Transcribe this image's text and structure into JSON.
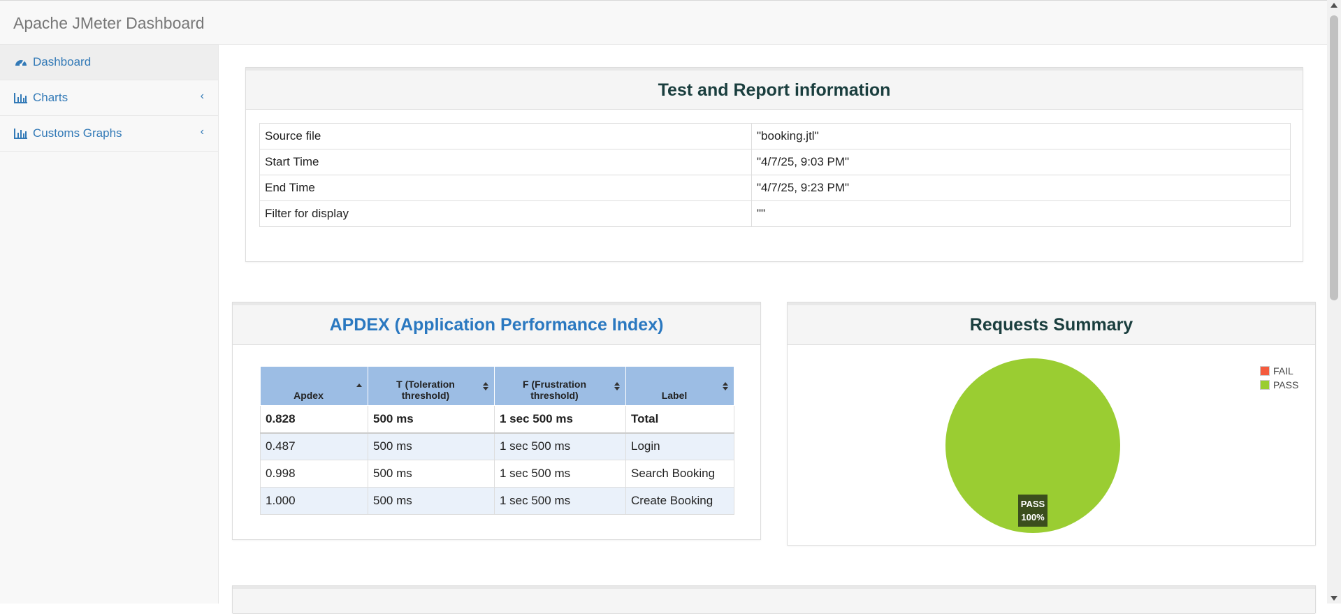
{
  "app": {
    "title": "Apache JMeter Dashboard"
  },
  "sidebar": {
    "items": [
      {
        "label": "Dashboard",
        "icon": "dashboard-icon",
        "active": true
      },
      {
        "label": "Charts",
        "icon": "bar-chart-icon"
      },
      {
        "label": "Customs Graphs",
        "icon": "bar-chart-icon"
      }
    ]
  },
  "test_info": {
    "title": "Test and Report information",
    "rows": [
      {
        "key": "Source file",
        "value": "\"booking.jtl\""
      },
      {
        "key": "Start Time",
        "value": "\"4/7/25, 9:03 PM\""
      },
      {
        "key": "End Time",
        "value": "\"4/7/25, 9:23 PM\""
      },
      {
        "key": "Filter for display",
        "value": "\"\""
      }
    ]
  },
  "apdex": {
    "title": "APDEX (Application Performance Index)",
    "headers": [
      "Apdex",
      "T (Toleration threshold)",
      "F (Frustration threshold)",
      "Label"
    ],
    "rows": [
      [
        "0.828",
        "500 ms",
        "1 sec 500 ms",
        "Total"
      ],
      [
        "0.487",
        "500 ms",
        "1 sec 500 ms",
        "Login"
      ],
      [
        "0.998",
        "500 ms",
        "1 sec 500 ms",
        "Search Booking"
      ],
      [
        "1.000",
        "500 ms",
        "1 sec 500 ms",
        "Create Booking"
      ]
    ]
  },
  "requests_summary": {
    "title": "Requests Summary",
    "legend": [
      {
        "label": "FAIL",
        "color": "#f45b3e"
      },
      {
        "label": "PASS",
        "color": "#9acd32"
      }
    ],
    "slice_label": "PASS",
    "slice_percent": "100%"
  },
  "chart_data": {
    "type": "pie",
    "categories": [
      "FAIL",
      "PASS"
    ],
    "values": [
      0,
      100
    ]
  },
  "colors": {
    "link": "#337ab7",
    "pass": "#9acd32",
    "fail": "#f45b3e",
    "apdex_header": "#9cbde4"
  }
}
